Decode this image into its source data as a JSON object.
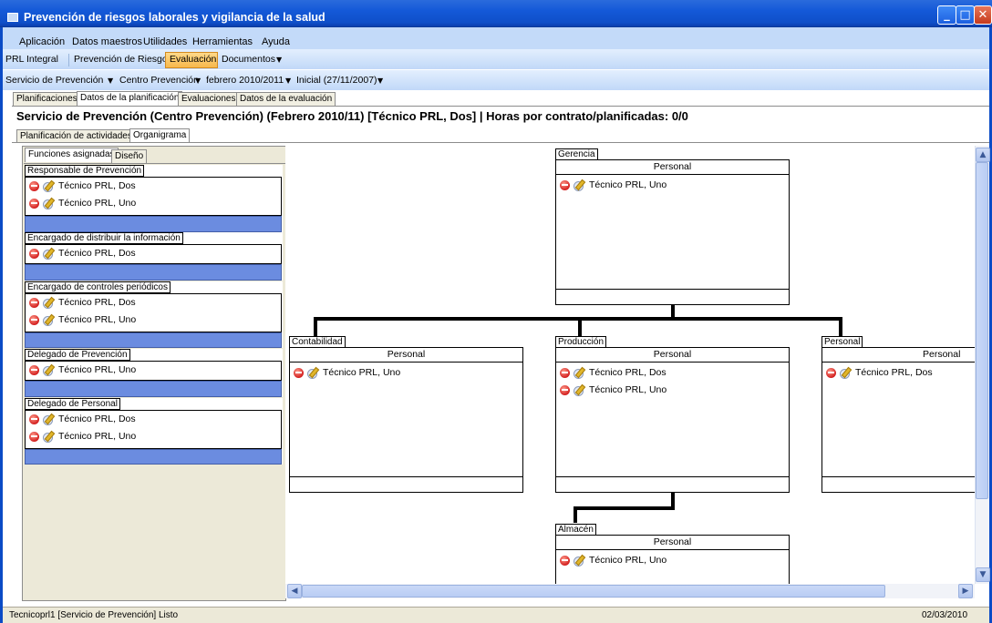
{
  "window": {
    "title": "Prevención de riesgos laborales y vigilancia de la salud"
  },
  "menu": [
    "Aplicación",
    "Datos maestros",
    "Utilidades",
    "Herramientas",
    "Ayuda"
  ],
  "toolbar1": {
    "items": [
      "PRL Integral",
      "Prevención de Riesgos",
      "Evaluación",
      "Documentos"
    ],
    "active": "Evaluación"
  },
  "toolbar2": {
    "items": [
      "Servicio de Prevención",
      "Centro Prevención",
      "febrero 2010/2011",
      "Inicial (27/11/2007)"
    ]
  },
  "tabs_main": [
    "Planificaciones",
    "Datos de la planificación",
    "Evaluaciones",
    "Datos de la evaluación"
  ],
  "heading": "Servicio de Prevención (Centro Prevención) (Febrero 2010/11) [Técnico PRL, Dos] | Horas por contrato/planificadas: 0/0",
  "tabs_sub": [
    "Planificación de actividades",
    "Organigrama"
  ],
  "tabs_left": [
    "Funciones asignadas",
    "Diseño"
  ],
  "roles": [
    {
      "title": "Responsable de Prevención",
      "people": [
        "Técnico PRL, Dos",
        "Técnico PRL, Uno"
      ]
    },
    {
      "title": "Encargado de distribuir la información",
      "people": [
        "Técnico PRL, Dos"
      ]
    },
    {
      "title": "Encargado de controles periódicos",
      "people": [
        "Técnico PRL, Dos",
        "Técnico PRL, Uno"
      ]
    },
    {
      "title": "Delegado de Prevención",
      "people": [
        "Técnico PRL, Uno"
      ]
    },
    {
      "title": "Delegado de Personal",
      "people": [
        "Técnico PRL, Dos",
        "Técnico PRL, Uno"
      ]
    }
  ],
  "org": {
    "gerencia": {
      "title": "Gerencia",
      "header": "Personal",
      "people": [
        "Técnico PRL, Uno"
      ]
    },
    "contabilidad": {
      "title": "Contabilidad",
      "header": "Personal",
      "people": [
        "Técnico PRL, Uno"
      ]
    },
    "produccion": {
      "title": "Producción",
      "header": "Personal",
      "people": [
        "Técnico PRL, Dos",
        "Técnico PRL, Uno"
      ]
    },
    "personal": {
      "title": "Personal",
      "header": "Personal",
      "people": [
        "Técnico PRL, Dos"
      ]
    },
    "almacen": {
      "title": "Almacén",
      "header": "Personal",
      "people": [
        "Técnico PRL, Uno"
      ]
    }
  },
  "status": {
    "text": "Tecnicoprl1 [Servicio de Prevención]  Listo",
    "date": "02/03/2010"
  },
  "colors": {
    "titlebar": "#1459d8",
    "role_bar": "#6b8ce0",
    "active_button": "#f7b84b"
  }
}
